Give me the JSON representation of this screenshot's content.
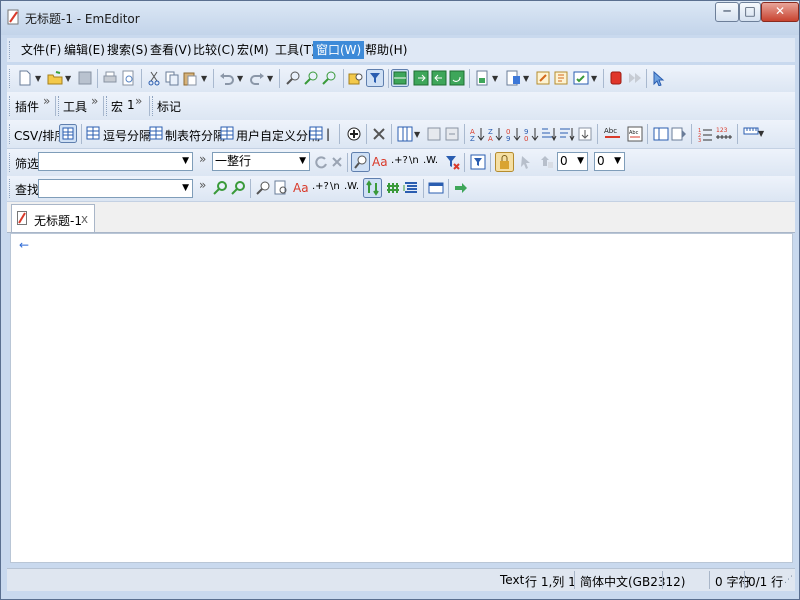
{
  "window": {
    "title": "无标题-1 - EmEditor",
    "buttons": {
      "minimize": "─",
      "maximize": "□",
      "close": "✕"
    }
  },
  "menu": {
    "items": [
      "文件(F)",
      "编辑(E)",
      "搜索(S)",
      "查看(V)",
      "比较(C)",
      "宏(M)",
      "工具(T)",
      "窗口(W)",
      "帮助(H)"
    ],
    "active_index": 7
  },
  "toolbars": {
    "row2": {
      "plugin": "插件",
      "tools": "工具",
      "macro": "宏",
      "macro_pos": "1",
      "bookmark": "标记",
      "chevron": "»"
    },
    "row3": {
      "csv": "CSV/排序",
      "comma": "逗号分隔",
      "tab": "制表符分隔",
      "user": "用户自定义分隔",
      "user_mark": "|"
    },
    "row4": {
      "filter_label": "筛选",
      "filter_value": "",
      "scope_value": "一整行",
      "num1": "0",
      "num2": "0"
    },
    "row5": {
      "find_label": "查找",
      "find_value": ""
    }
  },
  "document": {
    "tab_label": "无标题-1",
    "tab_close": "x",
    "caret_mark": "←"
  },
  "status": {
    "mode": "Text",
    "position": "行 1,列 1",
    "encoding": "简体中文(GB2312)",
    "chars": "0 字符",
    "lines": "0/1 行"
  },
  "colors": {
    "accent": "#3d8ad8",
    "window_frame": "#c9d9ee"
  }
}
